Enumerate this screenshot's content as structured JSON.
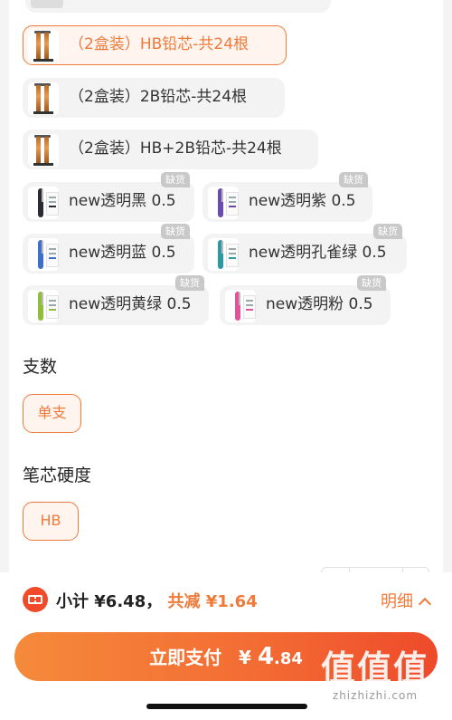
{
  "options": [
    {
      "label": "（2盒装）HB铅芯-共24根",
      "selected": true,
      "tag": "",
      "thumb": "lead-refill-box"
    },
    {
      "label": "（2盒装）2B铅芯-共24根",
      "selected": false,
      "tag": "",
      "thumb": "lead-refill-box"
    },
    {
      "label": "（2盒装）HB+2B铅芯-共24根",
      "selected": false,
      "tag": "",
      "thumb": "lead-refill-box"
    },
    {
      "label": "new透明黑 0.5",
      "selected": false,
      "tag": "缺货",
      "thumb": "pencil-black",
      "color": "#2b2b33"
    },
    {
      "label": "new透明紫 0.5",
      "selected": false,
      "tag": "缺货",
      "thumb": "pencil-purple",
      "color": "#6a4bb3"
    },
    {
      "label": "new透明蓝 0.5",
      "selected": false,
      "tag": "缺货",
      "thumb": "pencil-blue",
      "color": "#3f6fc9"
    },
    {
      "label": "new透明孔雀绿 0.5",
      "selected": false,
      "tag": "缺货",
      "thumb": "pencil-teal",
      "color": "#2a9aa3"
    },
    {
      "label": "new透明黄绿 0.5",
      "selected": false,
      "tag": "缺货",
      "thumb": "pencil-yellow-green",
      "color": "#8fbe3c"
    },
    {
      "label": "new透明粉 0.5",
      "selected": false,
      "tag": "缺货",
      "thumb": "pencil-pink",
      "color": "#e0559a"
    }
  ],
  "sections": {
    "count": {
      "title": "支数",
      "value": "单支"
    },
    "hardness": {
      "title": "笔芯硬度",
      "value": "HB"
    }
  },
  "footer": {
    "subtotal_label": "小计",
    "subtotal_value": "¥6.48，",
    "discount_label": "共减",
    "discount_value": "¥1.64",
    "detail_label": "明细",
    "pay_label": "立即支付",
    "pay_currency": "¥",
    "pay_integer": "4",
    "pay_decimal": ".84"
  },
  "watermark": {
    "main": "值值值",
    "site": "zhizhizhi.com"
  },
  "colors": {
    "accent": "#f07a3a",
    "tag_bg": "#c9c9c9",
    "pay_start": "#f58a3b",
    "pay_end": "#ee4a2b"
  }
}
